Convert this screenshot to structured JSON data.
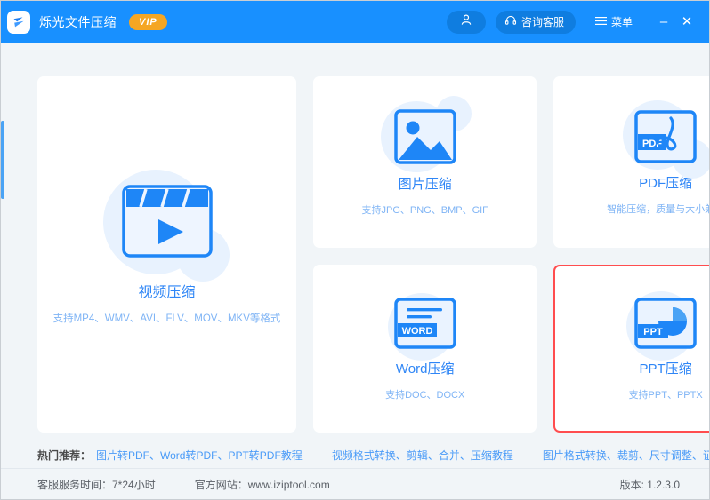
{
  "titlebar": {
    "app_title": "烁光文件压缩",
    "vip_badge": "VIP",
    "avatar_icon": "user-icon",
    "service_label": "咨询客服",
    "service_icon": "headset-icon",
    "menu_label": "菜单",
    "menu_icon": "hamburger-icon",
    "minimize_label": "–",
    "close_label": "✕",
    "brand_color": "#1890ff",
    "vip_color": "#f5a623"
  },
  "cards": [
    {
      "id": "video",
      "icon": "video-clapper-icon",
      "title": "视频压缩",
      "subtitle": "支持MP4、WMV、AVI、FLV、MOV、MKV等格式",
      "selected": false
    },
    {
      "id": "image",
      "icon": "picture-icon",
      "title": "图片压缩",
      "subtitle": "支持JPG、PNG、BMP、GIF",
      "selected": false
    },
    {
      "id": "pdf",
      "icon": "pdf-file-icon",
      "title": "PDF压缩",
      "subtitle": "智能压缩，质量与大小兼顾",
      "selected": false
    },
    {
      "id": "word",
      "icon": "word-file-icon",
      "title": "Word压缩",
      "subtitle": "支持DOC、DOCX",
      "selected": false
    },
    {
      "id": "ppt",
      "icon": "ppt-file-icon",
      "title": "PPT压缩",
      "subtitle": "支持PPT、PPTX",
      "selected": true,
      "highlight_color": "#ff4d4f"
    }
  ],
  "recommend": {
    "label": "热门推荐：",
    "links": [
      "图片转PDF、Word转PDF、PPT转PDF教程",
      "视频格式转换、剪辑、合并、压缩教程",
      "图片格式转换、裁剪、尺寸调整、证件照大小调整"
    ]
  },
  "footer": {
    "service_hours": "客服服务时间：7*24小时",
    "website": "官方网站：www.iziptool.com",
    "version": "版本: 1.2.3.0"
  }
}
